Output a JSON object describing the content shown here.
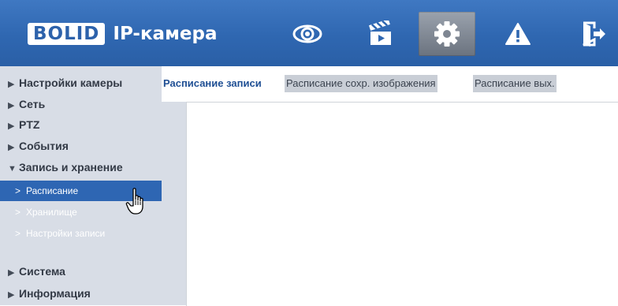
{
  "header": {
    "brand": "BOLID",
    "product": "IP-камера",
    "nav": [
      {
        "icon": "eye-icon",
        "label": "Live"
      },
      {
        "icon": "clapperboard-icon",
        "label": "Playback"
      },
      {
        "icon": "gear-icon",
        "label": "Settings",
        "active": true
      },
      {
        "icon": "warning-icon",
        "label": "Alarm"
      },
      {
        "icon": "logout-icon",
        "label": "Logout"
      }
    ]
  },
  "sidebar": {
    "items": [
      {
        "label": "Настройки камеры",
        "expanded": false
      },
      {
        "label": "Сеть",
        "expanded": false
      },
      {
        "label": "PTZ",
        "expanded": false
      },
      {
        "label": "События",
        "expanded": false
      },
      {
        "label": "Запись и хранение",
        "expanded": true
      },
      {
        "label": "Система",
        "expanded": false
      },
      {
        "label": "Информация",
        "expanded": false
      }
    ],
    "subitems": [
      {
        "label": "Расписание",
        "selected": true
      },
      {
        "label": "Хранилище",
        "selected": false
      },
      {
        "label": "Настройки записи",
        "selected": false
      }
    ]
  },
  "tabs": [
    {
      "label": "Расписание записи",
      "active": true
    },
    {
      "label": "Расписание сохр. изображения",
      "active": false
    },
    {
      "label": "Расписание вых.",
      "active": false
    }
  ],
  "colors": {
    "header": "#2f67b1",
    "sidebar": "#d8dde6",
    "selected": "#2e66b3",
    "active_tab_text": "#1f4f94"
  }
}
